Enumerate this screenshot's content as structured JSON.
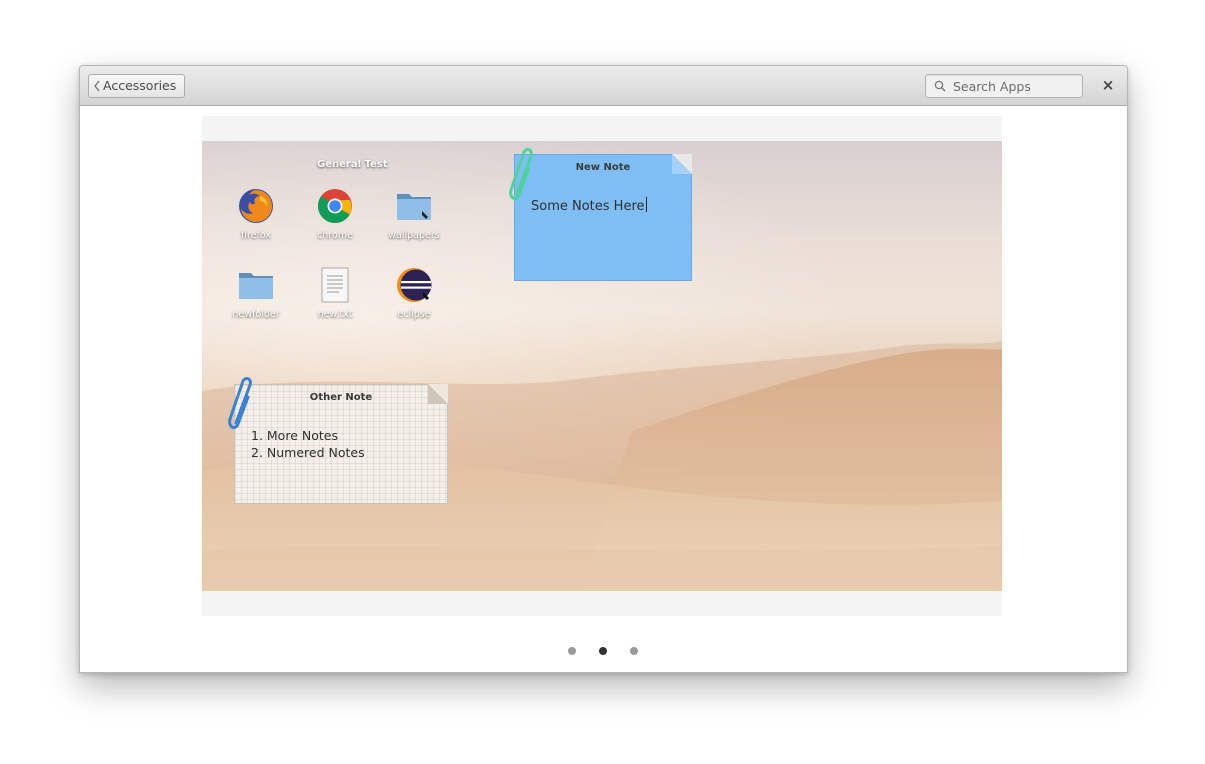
{
  "headerbar": {
    "back_label": "Accessories",
    "search_placeholder": "Search Apps",
    "close_glyph": "×"
  },
  "screenshot": {
    "group_title": "General Test",
    "desktop_icons": [
      {
        "label": "firefox",
        "icon": "firefox-icon"
      },
      {
        "label": "chrome",
        "icon": "chrome-icon"
      },
      {
        "label": "wallpapers",
        "icon": "folder-icon"
      },
      {
        "label": "newfolder",
        "icon": "folder-icon"
      },
      {
        "label": "new.txt",
        "icon": "text-file-icon"
      },
      {
        "label": "eclipse",
        "icon": "eclipse-icon"
      }
    ],
    "notes": [
      {
        "title": "New Note",
        "body": "Some Notes Here",
        "color": "#7ebef5",
        "clip_color": "#4fd1a0"
      },
      {
        "title": "Other Note",
        "items": [
          "1. More Notes",
          "2. Numered Notes"
        ],
        "color": "#f4efe8",
        "clip_color": "#3a82d4"
      }
    ]
  },
  "pagination": {
    "count": 3,
    "active_index": 1
  }
}
